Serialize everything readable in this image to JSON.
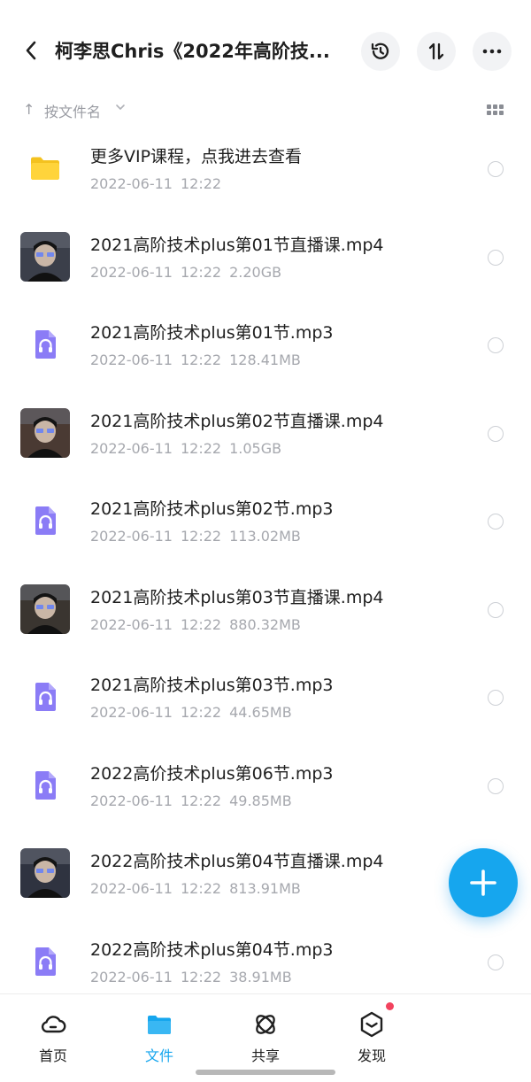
{
  "header": {
    "title": "柯李思Chris《2022年高阶技..."
  },
  "sort": {
    "label": "按文件名"
  },
  "files": [
    {
      "name": "更多VIP课程，点我进去查看",
      "date": "2022-06-11",
      "time": "12:22",
      "size": "",
      "type": "folder",
      "thumb_color": "#FFD43B"
    },
    {
      "name": "2021高阶技术plus第01节直播课.mp4",
      "date": "2022-06-11",
      "time": "12:22",
      "size": "2.20GB",
      "type": "video",
      "thumb_color": "#3b3f4a"
    },
    {
      "name": "2021高阶技术plus第01节.mp3",
      "date": "2022-06-11",
      "time": "12:22",
      "size": "128.41MB",
      "type": "audio",
      "thumb_color": "#8b7cf6"
    },
    {
      "name": "2021高阶技术plus第02节直播课.mp4",
      "date": "2022-06-11",
      "time": "12:22",
      "size": "1.05GB",
      "type": "video",
      "thumb_color": "#4a3a33"
    },
    {
      "name": "2021高阶技术plus第02节.mp3",
      "date": "2022-06-11",
      "time": "12:22",
      "size": "113.02MB",
      "type": "audio",
      "thumb_color": "#8b7cf6"
    },
    {
      "name": "2021高阶技术plus第03节直播课.mp4",
      "date": "2022-06-11",
      "time": "12:22",
      "size": "880.32MB",
      "type": "video",
      "thumb_color": "#3a3530"
    },
    {
      "name": "2021高阶技术plus第03节.mp3",
      "date": "2022-06-11",
      "time": "12:22",
      "size": "44.65MB",
      "type": "audio",
      "thumb_color": "#8b7cf6"
    },
    {
      "name": "2022高价技术plus第06节.mp3",
      "date": "2022-06-11",
      "time": "12:22",
      "size": "49.85MB",
      "type": "audio",
      "thumb_color": "#8b7cf6"
    },
    {
      "name": "2022高阶技术plus第04节直播课.mp4",
      "date": "2022-06-11",
      "time": "12:22",
      "size": "813.91MB",
      "type": "video",
      "thumb_color": "#2f3340"
    },
    {
      "name": "2022高阶技术plus第04节.mp3",
      "date": "2022-06-11",
      "time": "12:22",
      "size": "38.91MB",
      "type": "audio",
      "thumb_color": "#8b7cf6"
    }
  ],
  "tabs": [
    {
      "label": "首页",
      "icon": "cloud-icon",
      "active": false
    },
    {
      "label": "文件",
      "icon": "folder-icon",
      "active": true
    },
    {
      "label": "共享",
      "icon": "atom-icon",
      "active": false
    },
    {
      "label": "发现",
      "icon": "cube-icon",
      "active": false
    }
  ],
  "colors": {
    "accent": "#16a6ee",
    "badge": "#f2435e",
    "audio": "#8b7cf6",
    "folder": "#FFD43B"
  }
}
